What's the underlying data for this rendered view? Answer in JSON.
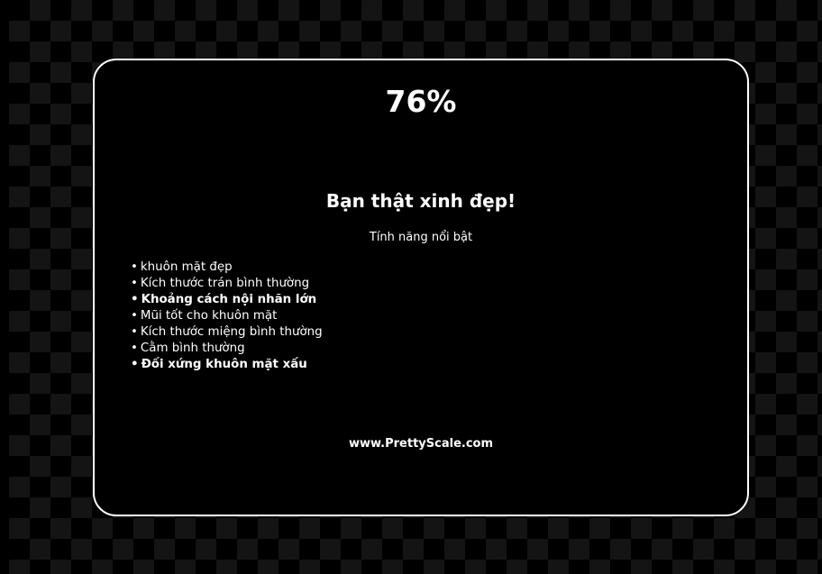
{
  "result": {
    "score": "76%",
    "headline": "Bạn thật xinh đẹp!",
    "subheading": "Tính năng nổi bật",
    "bullet": "•",
    "features": [
      {
        "text": "khuôn mặt đẹp",
        "bold": false
      },
      {
        "text": "Kích thước trán bình thường",
        "bold": false
      },
      {
        "text": "Khoảng cách nội nhãn lớn",
        "bold": true
      },
      {
        "text": "Mũi tốt cho khuôn mặt",
        "bold": false
      },
      {
        "text": "Kích thước miệng bình thường",
        "bold": false
      },
      {
        "text": "Cằm bình thường",
        "bold": false
      },
      {
        "text": "Đối xứng khuôn mặt xấu",
        "bold": true
      }
    ],
    "website": "www.PrettyScale.com"
  },
  "colors": {
    "background": "#000000",
    "checker": "#141414",
    "text": "#ffffff",
    "border": "#ffffff"
  }
}
